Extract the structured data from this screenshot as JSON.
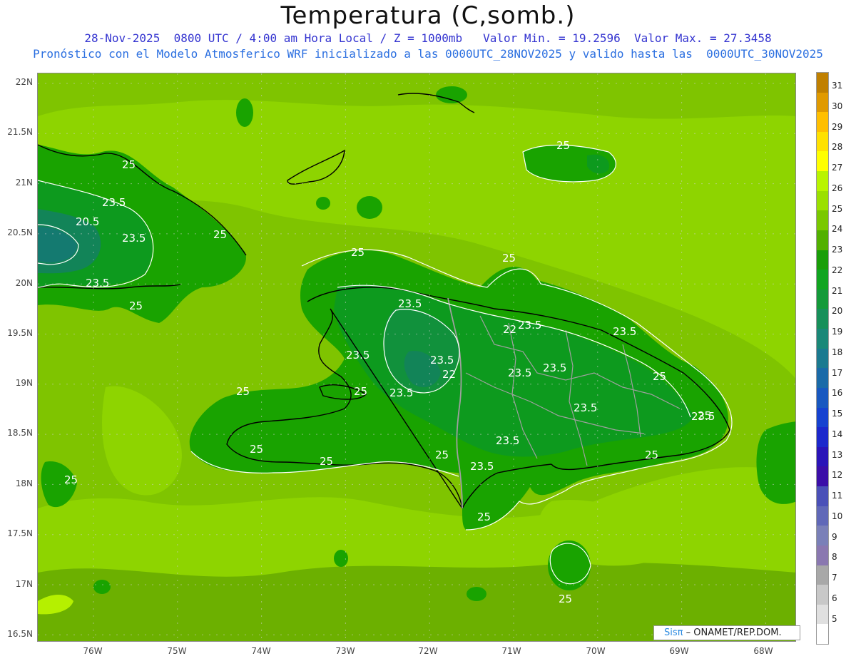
{
  "header": {
    "title": "Temperatura (C,somb.)",
    "subtitle1": "28-Nov-2025  0800 UTC / 4:00 am Hora Local / Z = 1000mb   Valor Min. = 19.2596  Valor Max. = 27.3458",
    "subtitle2": "Pronóstico con el Modelo Atmosferico WRF inicializado a las 0000UTC_28NOV2025 y valido hasta las  0000UTC_30NOV2025"
  },
  "axes": {
    "lat_labels": [
      "22N",
      "21.5N",
      "21N",
      "20.5N",
      "20N",
      "19.5N",
      "19N",
      "18.5N",
      "18N",
      "17.5N",
      "17N",
      "16.5N"
    ],
    "lon_labels": [
      "76W",
      "75W",
      "74W",
      "73W",
      "72W",
      "71W",
      "70W",
      "69W",
      "68W"
    ]
  },
  "colorbar": {
    "labels": [
      "31",
      "30",
      "29",
      "28",
      "27",
      "26",
      "25",
      "24",
      "23",
      "22",
      "21",
      "20",
      "19",
      "18",
      "17",
      "16",
      "15",
      "14",
      "13",
      "12",
      "11",
      "10",
      "9",
      "8",
      "7",
      "6",
      "5"
    ],
    "colors": [
      "#c08000",
      "#e09a00",
      "#ffbf00",
      "#ffe100",
      "#ffff00",
      "#b9f400",
      "#9be000",
      "#7ac800",
      "#52b000",
      "#1a9e08",
      "#11a520",
      "#149a3a",
      "#17905a",
      "#1a8878",
      "#1b7a90",
      "#1a6aa8",
      "#1858c0",
      "#1642d0",
      "#1c28cc",
      "#2a14b8",
      "#3b0ea8",
      "#4a50b8",
      "#6068b8",
      "#7a80b8",
      "#8a78b0",
      "#a8a8a8",
      "#c8c8c8",
      "#e0e0e0",
      "#ffffff"
    ]
  },
  "map_colors": {
    "sea_light": "#8ed400",
    "sea_mid": "#7fc400",
    "sea_dark": "#6cb000",
    "land_24": "#19a300",
    "land_23": "#0d9a1e",
    "land_22": "#11913c",
    "land_21": "#128458",
    "land_20": "#147a70",
    "warm_patch": "#b5f000",
    "coast": "#000000",
    "border": "#a0a0a0",
    "contour": "#ffffff"
  },
  "contour_labels": [
    {
      "text": "25"
    },
    {
      "text": "23.5"
    },
    {
      "text": "20.5"
    },
    {
      "text": "23.5"
    },
    {
      "text": "25"
    },
    {
      "text": "23.5"
    },
    {
      "text": "25"
    },
    {
      "text": "25"
    },
    {
      "text": "25"
    },
    {
      "text": "25"
    },
    {
      "text": "23.5"
    },
    {
      "text": "22"
    },
    {
      "text": "23.5"
    },
    {
      "text": "23.5"
    },
    {
      "text": "23.5"
    },
    {
      "text": "23.5"
    },
    {
      "text": "22"
    },
    {
      "text": "25"
    },
    {
      "text": "23.5"
    },
    {
      "text": "23.5"
    },
    {
      "text": "23.5"
    },
    {
      "text": "23.5"
    },
    {
      "text": "23.5"
    },
    {
      "text": "25"
    },
    {
      "text": "23.5"
    },
    {
      "text": "25"
    },
    {
      "text": "25"
    },
    {
      "text": "25"
    },
    {
      "text": "25"
    },
    {
      "text": "25"
    },
    {
      "text": "23.5"
    },
    {
      "text": "25"
    },
    {
      "text": "25"
    },
    {
      "text": "25"
    },
    {
      "text": "25"
    }
  ],
  "credit": {
    "brand": "Sisπ",
    "org": " – ONAMET/REP.DOM."
  }
}
